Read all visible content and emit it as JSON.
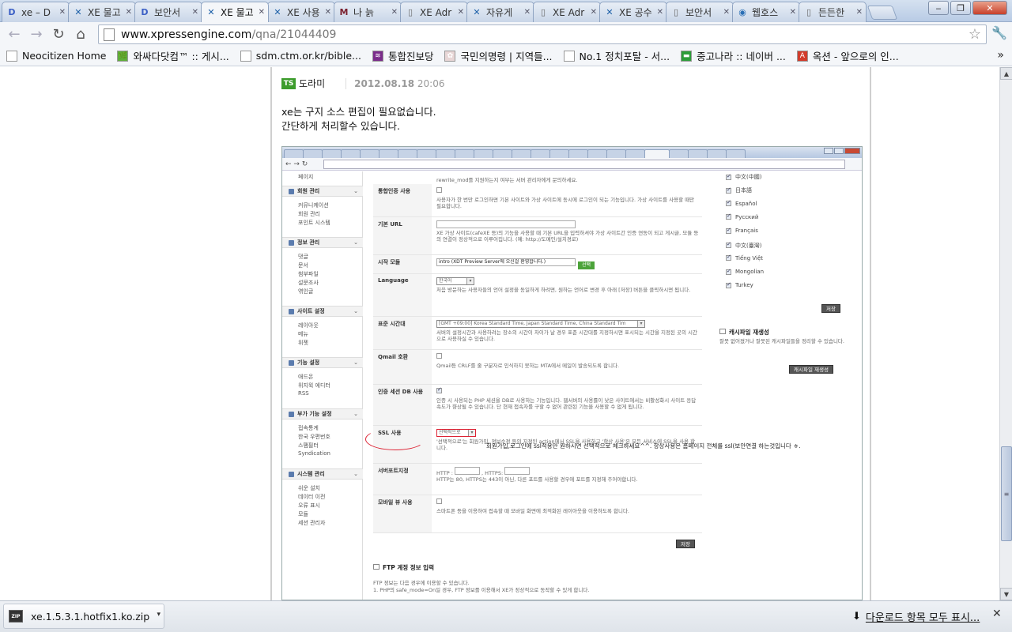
{
  "tabs": [
    {
      "label": "xe – D",
      "icon": "D",
      "color": "#3b5fc5",
      "active": false
    },
    {
      "label": "XE 물고",
      "icon": "✕",
      "color": "#1c5fa8",
      "active": false
    },
    {
      "label": "보안서",
      "icon": "D",
      "color": "#3b5fc5",
      "active": false
    },
    {
      "label": "XE 물고",
      "icon": "✕",
      "color": "#1c5fa8",
      "active": true
    },
    {
      "label": "XE 사용",
      "icon": "✕",
      "color": "#1c5fa8",
      "active": false
    },
    {
      "label": "나 늙",
      "icon": "M",
      "color": "#7a1f2d",
      "active": false
    },
    {
      "label": "XE Adr",
      "icon": "▯",
      "color": "#666666",
      "active": false
    },
    {
      "label": "자유게",
      "icon": "✕",
      "color": "#1c5fa8",
      "active": false
    },
    {
      "label": "XE Adr",
      "icon": "▯",
      "color": "#666666",
      "active": false
    },
    {
      "label": "XE 공수",
      "icon": "✕",
      "color": "#1c5fa8",
      "active": false
    },
    {
      "label": "보안서",
      "icon": "▯",
      "color": "#666666",
      "active": false
    },
    {
      "label": "웹호스",
      "icon": "◉",
      "color": "#2a6fb5",
      "active": false
    },
    {
      "label": "든든한",
      "icon": "▯",
      "color": "#666666",
      "active": false
    }
  ],
  "address": {
    "host": "www.xpressengine.com",
    "path": "/qna/21044409"
  },
  "bookmarks": [
    {
      "label": "Neocitizen Home",
      "icon": "page-icon"
    },
    {
      "label": "와싸다닷컴™ :: 게시...",
      "icon": "leaf-icon"
    },
    {
      "label": "sdm.ctm.or.kr/bible...",
      "icon": "page-icon"
    },
    {
      "label": "통합진보당",
      "icon": "flag-icon"
    },
    {
      "label": "국민의명령 | 지역들...",
      "icon": "flower-icon"
    },
    {
      "label": "No.1 정치포탈 - 서...",
      "icon": "page-icon"
    },
    {
      "label": "중고나라 :: 네이버 ...",
      "icon": "card-icon"
    },
    {
      "label": "옥션 - 앞으로의 인...",
      "icon": "a-icon"
    }
  ],
  "post": {
    "badge": "TS",
    "author": "도라미",
    "date": "2012.08.18",
    "time": "20:06",
    "body": [
      "xe는 구지 소스 편집이 필요없습니다.",
      "간단하게 처리할수 있습니다."
    ]
  },
  "shot": {
    "menu": [
      {
        "title": "회원 관리",
        "items": [
          "커뮤니케이션",
          "회원 관리",
          "포인트 시스템"
        ]
      },
      {
        "title": "정보 관리",
        "items": [
          "댓글",
          "문서",
          "첨부파일",
          "설문조사",
          "엮인글"
        ]
      },
      {
        "title": "사이트 설정",
        "items": [
          "레이아웃",
          "메뉴",
          "위젯"
        ]
      },
      {
        "title": "기능 설정",
        "items": [
          "애드온",
          "위지윅 에디터",
          "RSS"
        ]
      },
      {
        "title": "부가 기능 설정",
        "items": [
          "접속통계",
          "한국 우편번호",
          "스팸필터",
          "Syndication"
        ]
      },
      {
        "title": "시스템 관리",
        "items": [
          "쉬운 설치",
          "데이터 이전",
          "오류 표시",
          "모듈",
          "세션 관리자"
        ]
      }
    ],
    "menu_top_item": "페이지",
    "top_desc": "rewrite_mod를 지원하는지 여부는 서버 관리자에게 문의하세요.",
    "rows": [
      {
        "label": "통합인증 사용",
        "desc": "사용자가 한 번만 로그인하면 기본 사이트와 가상 사이트에 동시에 로그인이 되는 기능입니다. 가상 사이트를 사용할 때만 필요합니다."
      },
      {
        "label": "기본 URL",
        "desc": "XE 가상 사이트(cafeXE 등)의 기능을 사용할 때 기본 URL을 입력하셔야 가상 사이트간 인증 연동이 되고 게시글, 모듈 등의 연결이 정상적으로 이루어집니다. (예: http://도메인/설치경로)"
      },
      {
        "label": "시작 모듈",
        "value": "intro (XDT Preview Server에 오신걸 환영합니다.)",
        "button": "선택"
      },
      {
        "label": "Language",
        "value": "한국어",
        "desc": "처음 방문하는 사용자들의 언어 설정을 동일하게 하려면, 원하는 언어로 변경 후 아래 [저장] 버튼을 클릭하시면 됩니다."
      },
      {
        "label": "표준 시간대",
        "value": "[GMT +09:00] Korea Standard Time, Japan Standard Time, China Standard Tim",
        "desc": "서버의 설정시간과 사용하려는 장소의 시간이 차이가 날 경우 표준 시간대를 지정하시면 표시되는 시간을 지정된 곳의 시간으로 사용하실 수 있습니다."
      },
      {
        "label": "Qmail 호환",
        "desc": "Qmail등 CRLF를 줄 구분자로 인식하지 못하는 MTA에서 메일이 발송되도록 합니다."
      },
      {
        "label": "인증 세션 DB 사용",
        "desc": "인증 시 사용되는 PHP 세션을 DB로 사용하는 기능입니다. 웹서버의 사용률이 낮은 사이트에서는 비활성화시 사이트 응답 속도가 향상될 수 있습니다. 단 현재 접속자를 구할 수 없어 관련된 기능을 사용할 수 없게 됩니다."
      },
      {
        "label": "SSL 사용",
        "value": "선택적으로",
        "desc": "'선택적으로'는 회원가입, 정보수정 등의 지정된 action에서 SSL을 사용하고 '항상 사용'은 모든 서비스에 SSL을 사용 합니다."
      },
      {
        "label": "서버포트지정",
        "http": "HTTP :",
        "https": ", HTTPS:",
        "desc": "HTTP는 80, HTTPS는 443이 아닌, 다른 포트를 사용할 경우에 포트를 지정해 주어야합니다."
      },
      {
        "label": "모바일 뷰 사용",
        "desc": "스마트폰 등을 이용하여 접속할 때 모바일 화면에 최적화된 레이아웃을 이용하도록 합니다."
      }
    ],
    "ssl_note": "회원가입,로그인에 ssl적용만 원하시면 선택적으로 체크하세요^^. 항상사용은 홈페이지 전체를 ssl(보안연결 하는것입니다 ㅎ.",
    "save_label": "저장",
    "languages": [
      "中文(中國)",
      "日本語",
      "Español",
      "Русский",
      "Français",
      "中文(臺灣)",
      "Tiếng Việt",
      "Mongolian",
      "Turkey"
    ],
    "lang_save": "저장",
    "cache_title": "캐시파일 재생성",
    "cache_desc": "잘못 없어졌거나 잘못된 캐시파일들을 정리할 수 있습니다.",
    "cache_button": "캐시파일 재생성",
    "ftp_title": "FTP 계정 정보 입력",
    "ftp_desc": [
      "FTP 정보는 다음 경우에 이용할 수 있습니다.",
      "1. PHP의 safe_mode=On일 경우, FTP 정보를 이용해서 XE가 정상적으로 동작할 수 있게 합니다."
    ]
  },
  "download": {
    "file": "xe.1.5.3.1.hotfix1.ko.zip",
    "icon_text": "ZIP",
    "show_all": "다운로드 항목 모두 표시..."
  }
}
